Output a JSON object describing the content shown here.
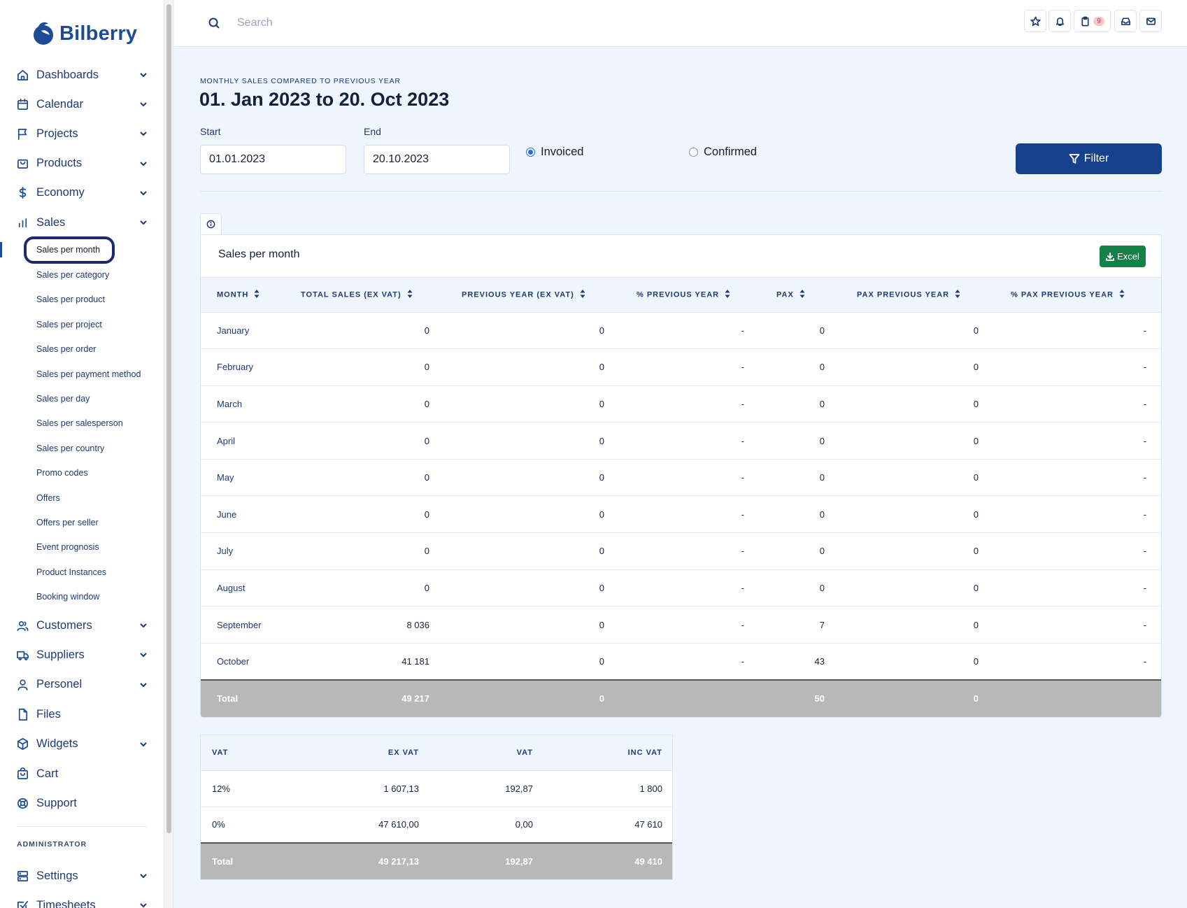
{
  "app": {
    "name": "Bilberry"
  },
  "sidebar": {
    "nav": [
      {
        "label": "Dashboards",
        "icon": "home-icon",
        "expandable": true
      },
      {
        "label": "Calendar",
        "icon": "calendar-icon",
        "expandable": true
      },
      {
        "label": "Projects",
        "icon": "flag-icon",
        "expandable": true
      },
      {
        "label": "Products",
        "icon": "bag-icon",
        "expandable": true
      },
      {
        "label": "Economy",
        "icon": "dollar-icon",
        "expandable": true
      },
      {
        "label": "Sales",
        "icon": "bar-chart-icon",
        "expandable": true
      }
    ],
    "sales_sub": [
      "Sales per month",
      "Sales per category",
      "Sales per product",
      "Sales per project",
      "Sales per order",
      "Sales per payment method",
      "Sales per day",
      "Sales per salesperson",
      "Sales per country",
      "Promo codes",
      "Offers",
      "Offers per seller",
      "Event prognosis",
      "Product Instances",
      "Booking window"
    ],
    "nav_bottom": [
      {
        "label": "Customers",
        "icon": "users-icon",
        "expandable": true
      },
      {
        "label": "Suppliers",
        "icon": "truck-icon",
        "expandable": true
      },
      {
        "label": "Personel",
        "icon": "user-icon",
        "expandable": true
      },
      {
        "label": "Files",
        "icon": "file-icon",
        "expandable": false
      },
      {
        "label": "Widgets",
        "icon": "box-icon",
        "expandable": true
      },
      {
        "label": "Cart",
        "icon": "cart-icon",
        "expandable": false
      },
      {
        "label": "Support",
        "icon": "lifebuoy-icon",
        "expandable": false
      }
    ],
    "admin_section": "ADMINISTRATOR",
    "admin_nav": [
      {
        "label": "Settings",
        "icon": "server-icon",
        "expandable": true
      },
      {
        "label": "Timesheets",
        "icon": "check-square-icon",
        "expandable": true
      }
    ]
  },
  "topbar": {
    "search_placeholder": "Search",
    "notification_count": "9"
  },
  "page": {
    "eyebrow": "MONTHLY SALES COMPARED TO PREVIOUS YEAR",
    "title": "01. Jan 2023 to 20. Oct 2023",
    "start_label": "Start",
    "start_value": "01.01.2023",
    "end_label": "End",
    "end_value": "20.10.2023",
    "radio_invoiced": "Invoiced",
    "radio_confirmed": "Confirmed",
    "selected_radio": "Invoiced",
    "filter_label": "Filter"
  },
  "sales_table": {
    "title": "Sales per month",
    "excel_label": "Excel",
    "headers": [
      "MONTH",
      "TOTAL SALES (EX VAT)",
      "PREVIOUS YEAR (EX VAT)",
      "% PREVIOUS YEAR",
      "PAX",
      "PAX PREVIOUS YEAR",
      "% PAX PREVIOUS YEAR"
    ],
    "rows": [
      [
        "January",
        "0",
        "0",
        "-",
        "0",
        "0",
        "-"
      ],
      [
        "February",
        "0",
        "0",
        "-",
        "0",
        "0",
        "-"
      ],
      [
        "March",
        "0",
        "0",
        "-",
        "0",
        "0",
        "-"
      ],
      [
        "April",
        "0",
        "0",
        "-",
        "0",
        "0",
        "-"
      ],
      [
        "May",
        "0",
        "0",
        "-",
        "0",
        "0",
        "-"
      ],
      [
        "June",
        "0",
        "0",
        "-",
        "0",
        "0",
        "-"
      ],
      [
        "July",
        "0",
        "0",
        "-",
        "0",
        "0",
        "-"
      ],
      [
        "August",
        "0",
        "0",
        "-",
        "0",
        "0",
        "-"
      ],
      [
        "September",
        "8 036",
        "0",
        "-",
        "7",
        "0",
        "-"
      ],
      [
        "October",
        "41 181",
        "0",
        "-",
        "43",
        "0",
        "-"
      ]
    ],
    "total": [
      "Total",
      "49 217",
      "0",
      "",
      "50",
      "0",
      ""
    ]
  },
  "vat_table": {
    "headers": [
      "VAT",
      "EX VAT",
      "VAT",
      "INC VAT"
    ],
    "rows": [
      [
        "12%",
        "1 607,13",
        "192,87",
        "1 800"
      ],
      [
        "0%",
        "47 610,00",
        "0,00",
        "47 610"
      ]
    ],
    "total": [
      "Total",
      "49 217,13",
      "192,87",
      "49 410"
    ]
  },
  "colors": {
    "brand": "#1e4b96",
    "filter_button": "#17418c",
    "excel_button": "#168049",
    "total_row": "#b8b8b8",
    "background": "#eef5fd"
  }
}
